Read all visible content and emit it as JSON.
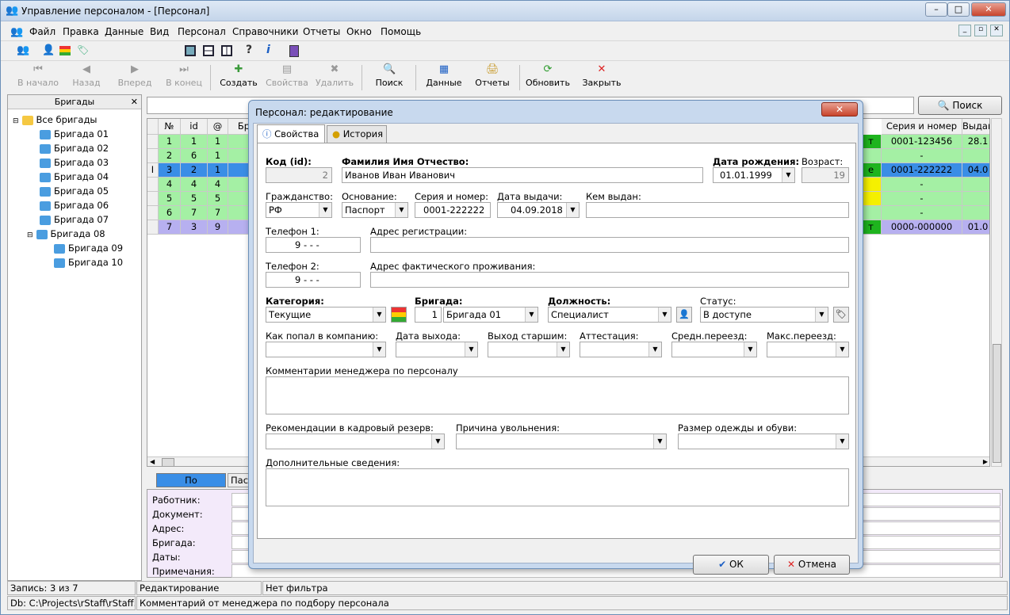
{
  "window": {
    "title": "Управление персоналом - [Персонал]",
    "minimize": "–",
    "maximize": "□",
    "close": "✕"
  },
  "menu": [
    "Файл",
    "Правка",
    "Данные",
    "Вид",
    "Персонал",
    "Справочники",
    "Отчеты",
    "Окно",
    "Помощь"
  ],
  "toolbar": {
    "first": "В начало",
    "prev": "Назад",
    "next": "Вперед",
    "last": "В конец",
    "create": "Создать",
    "props": "Свойства",
    "delete": "Удалить",
    "search": "Поиск",
    "data": "Данные",
    "reports": "Отчеты",
    "refresh": "Обновить",
    "close": "Закрыть"
  },
  "left": {
    "header": "Бригады",
    "close": "✕",
    "root": "Все бригады",
    "items": [
      "Бригада 01",
      "Бригада 02",
      "Бригада 03",
      "Бригада 04",
      "Бригада 05",
      "Бригада 06",
      "Бригада 07",
      "Бригада 08",
      "Бригада 09",
      "Бригада 10"
    ]
  },
  "searchbox": {
    "button": "Поиск"
  },
  "grid": {
    "headers": [
      "№",
      "id",
      "@",
      "Бр",
      "Серия и номер",
      "Выдан"
    ],
    "rows": [
      {
        "n": "1",
        "id": "1",
        "at": "1",
        "right_tag": "т",
        "series": "0001-123456",
        "issued": "28.1"
      },
      {
        "n": "2",
        "id": "6",
        "at": "1",
        "right_tag": "",
        "series": "-",
        "issued": ""
      },
      {
        "n": "3",
        "id": "2",
        "at": "1",
        "right_tag": "е",
        "series": "0001-222222",
        "issued": "04.0"
      },
      {
        "n": "4",
        "id": "4",
        "at": "4",
        "right_tag": "",
        "series": "-",
        "issued": ""
      },
      {
        "n": "5",
        "id": "5",
        "at": "5",
        "right_tag": "",
        "series": "-",
        "issued": ""
      },
      {
        "n": "6",
        "id": "7",
        "at": "7",
        "right_tag": "",
        "series": "-",
        "issued": ""
      },
      {
        "n": "7",
        "id": "3",
        "at": "9",
        "right_tag": "т",
        "series": "0000-000000",
        "issued": "01.0"
      }
    ],
    "row_colors": [
      "#a4f0a4",
      "#a4f0a4",
      "#3a8ee6",
      "#a4f0a4",
      "#a4f0a4",
      "#a4f0a4",
      "#b7b0f0"
    ]
  },
  "bottom_tabs": [
    "По умолчанию",
    "Пас"
  ],
  "details_labels": [
    "Работник:",
    "Документ:",
    "Адрес:",
    "Бригада:",
    "Даты:",
    "Примечания:"
  ],
  "status": {
    "record": "Запись: 3 из 7",
    "mode": "Редактирование",
    "filter": "Нет фильтра",
    "db": "Db: C:\\Projects\\rStaff\\rStaff.rr",
    "hint": "Комментарий от менеджера по подбору персонала"
  },
  "dialog": {
    "title": "Персонал: редактирование",
    "tabs": [
      "Свойства",
      "История"
    ],
    "labels": {
      "code": "Код (id):",
      "fio": "Фамилия Имя Отчество:",
      "dob": "Дата рождения:",
      "age": "Возраст:",
      "citizenship": "Гражданство:",
      "basis": "Основание:",
      "series": "Серия и номер:",
      "issue_date": "Дата выдачи:",
      "issued_by": "Кем выдан:",
      "phone1": "Телефон 1:",
      "reg_addr": "Адрес регистрации:",
      "phone2": "Телефон 2:",
      "fact_addr": "Адрес фактического проживания:",
      "category": "Категория:",
      "brigade": "Бригада:",
      "position": "Должность:",
      "status": "Статус:",
      "how_joined": "Как попал в компанию:",
      "exit_date": "Дата выхода:",
      "senior_exit": "Выход старшим:",
      "attestation": "Аттестация:",
      "avg_move": "Средн.переезд:",
      "max_move": "Макс.переезд:",
      "comments": "Комментарии менеджера по персоналу",
      "recommend": "Рекомендации в кадровый резерв:",
      "reason": "Причина увольнения:",
      "size": "Размер одежды и обуви:",
      "extra": "Дополнительные сведения:"
    },
    "values": {
      "code": "2",
      "fio": "Иванов Иван Иванович",
      "dob": "01.01.1999",
      "age": "19",
      "citizenship": "РФ",
      "basis": "Паспорт",
      "series": "0001-222222",
      "issue_date": "04.09.2018",
      "issued_by": "",
      "phone1": "9 - - -",
      "reg_addr": "",
      "phone2": "9 - - -",
      "fact_addr": "",
      "category": "Текущие",
      "brigade_num": "1",
      "brigade": "Бригада 01",
      "position": "Специалист",
      "status": "В доступе"
    },
    "ok": "ОК",
    "cancel": "Отмена"
  }
}
